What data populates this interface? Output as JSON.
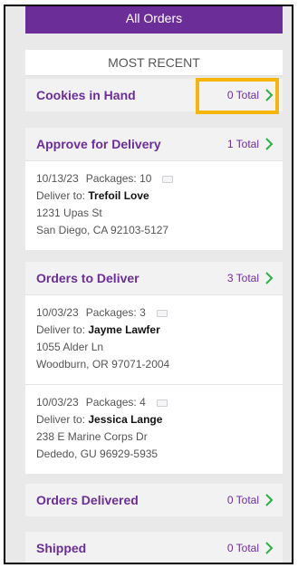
{
  "header": {
    "title": "All Orders"
  },
  "filter": {
    "label": "MOST RECENT"
  },
  "sections": [
    {
      "title": "Cookies in Hand",
      "total": "0 Total",
      "orders": []
    },
    {
      "title": "Approve for Delivery",
      "total": "1 Total",
      "orders": [
        {
          "date": "10/13/23",
          "packages": "Packages: 10",
          "deliver_label": "Deliver to:",
          "recipient": "Trefoil Love",
          "street": "1231 Upas St",
          "city": "San Diego, CA 92103-5127"
        }
      ]
    },
    {
      "title": "Orders to Deliver",
      "total": "3 Total",
      "orders": [
        {
          "date": "10/03/23",
          "packages": "Packages: 3",
          "deliver_label": "Deliver to:",
          "recipient": "Jayme Lawfer",
          "street": "1055 Alder Ln",
          "city": "Woodburn, OR 97071-2004"
        },
        {
          "date": "10/03/23",
          "packages": "Packages: 4",
          "deliver_label": "Deliver to:",
          "recipient": "Jessica Lange",
          "street": "238 E Marine Corps Dr",
          "city": "Dededo, GU 96929-5935"
        }
      ]
    },
    {
      "title": "Orders Delivered",
      "total": "0 Total",
      "orders": []
    },
    {
      "title": "Shipped",
      "total": "0 Total",
      "orders": []
    }
  ],
  "colors": {
    "brand_purple": "#6b2e98",
    "chevron_green": "#2fae4a",
    "highlight_yellow": "#f5b50a"
  },
  "icons": {
    "chevron": "chevron-right-icon",
    "package": "package-icon"
  }
}
